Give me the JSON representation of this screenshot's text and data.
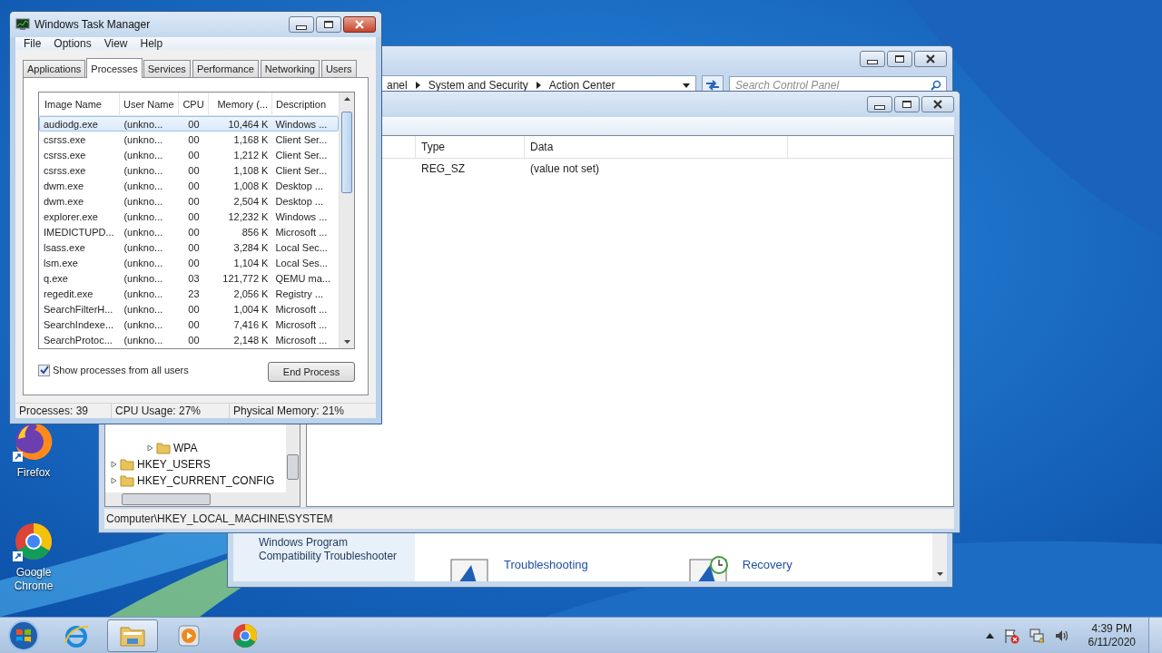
{
  "desktop": {
    "icons": [
      {
        "kind": "firefox",
        "label": "Firefox"
      },
      {
        "kind": "chrome",
        "label": "Google Chrome"
      }
    ]
  },
  "control_panel": {
    "breadcrumb": [
      "anel",
      "System and Security",
      "Action Center"
    ],
    "search": {
      "placeholder": "Search Control Panel"
    },
    "sidebar_link": "Windows Program Compatibility Troubleshooter",
    "items": [
      {
        "kind": "troubleshooting",
        "title": "Troubleshooting"
      },
      {
        "kind": "recovery",
        "title": "Recovery"
      }
    ]
  },
  "registry_editor": {
    "tree": [
      {
        "children": [
          {
            "label": "WPA",
            "expanded": false
          }
        ]
      },
      {
        "label": "HKEY_USERS",
        "expanded": false
      },
      {
        "label": "HKEY_CURRENT_CONFIG",
        "expanded": false
      }
    ],
    "columns": [
      "Type",
      "Data"
    ],
    "rows": [
      {
        "type": "REG_SZ",
        "data": "(value not set)"
      }
    ],
    "status_bar": "Computer\\HKEY_LOCAL_MACHINE\\SYSTEM"
  },
  "task_manager": {
    "title": "Windows Task Manager",
    "menu": [
      "File",
      "Options",
      "View",
      "Help"
    ],
    "tabs": [
      {
        "label": "Applications",
        "selected": false
      },
      {
        "label": "Processes",
        "selected": true
      },
      {
        "label": "Services",
        "selected": false
      },
      {
        "label": "Performance",
        "selected": false
      },
      {
        "label": "Networking",
        "selected": false
      },
      {
        "label": "Users",
        "selected": false
      }
    ],
    "columns": [
      "Image Name",
      "User Name",
      "CPU",
      "Memory (...",
      "Description"
    ],
    "processes": [
      {
        "image_name": "audiodg.exe",
        "user_name": "(unkno...",
        "cpu": "00",
        "memory": "10,464 K",
        "description": "Windows ...",
        "selected": true
      },
      {
        "image_name": "csrss.exe",
        "user_name": "(unkno...",
        "cpu": "00",
        "memory": "1,168 K",
        "description": "Client Ser...",
        "selected": false
      },
      {
        "image_name": "csrss.exe",
        "user_name": "(unkno...",
        "cpu": "00",
        "memory": "1,212 K",
        "description": "Client Ser...",
        "selected": false
      },
      {
        "image_name": "csrss.exe",
        "user_name": "(unkno...",
        "cpu": "00",
        "memory": "1,108 K",
        "description": "Client Ser...",
        "selected": false
      },
      {
        "image_name": "dwm.exe",
        "user_name": "(unkno...",
        "cpu": "00",
        "memory": "1,008 K",
        "description": "Desktop ...",
        "selected": false
      },
      {
        "image_name": "dwm.exe",
        "user_name": "(unkno...",
        "cpu": "00",
        "memory": "2,504 K",
        "description": "Desktop ...",
        "selected": false
      },
      {
        "image_name": "explorer.exe",
        "user_name": "(unkno...",
        "cpu": "00",
        "memory": "12,232 K",
        "description": "Windows ...",
        "selected": false
      },
      {
        "image_name": "IMEDICTUPD...",
        "user_name": "(unkno...",
        "cpu": "00",
        "memory": "856 K",
        "description": "Microsoft ...",
        "selected": false
      },
      {
        "image_name": "lsass.exe",
        "user_name": "(unkno...",
        "cpu": "00",
        "memory": "3,284 K",
        "description": "Local Sec...",
        "selected": false
      },
      {
        "image_name": "lsm.exe",
        "user_name": "(unkno...",
        "cpu": "00",
        "memory": "1,104 K",
        "description": "Local Ses...",
        "selected": false
      },
      {
        "image_name": "q.exe",
        "user_name": "(unkno...",
        "cpu": "03",
        "memory": "121,772 K",
        "description": "QEMU ma...",
        "selected": false
      },
      {
        "image_name": "regedit.exe",
        "user_name": "(unkno...",
        "cpu": "23",
        "memory": "2,056 K",
        "description": "Registry ...",
        "selected": false
      },
      {
        "image_name": "SearchFilterH...",
        "user_name": "(unkno...",
        "cpu": "00",
        "memory": "1,004 K",
        "description": "Microsoft ...",
        "selected": false
      },
      {
        "image_name": "SearchIndexe...",
        "user_name": "(unkno...",
        "cpu": "00",
        "memory": "7,416 K",
        "description": "Microsoft ...",
        "selected": false
      },
      {
        "image_name": "SearchProtoc...",
        "user_name": "(unkno...",
        "cpu": "00",
        "memory": "2,148 K",
        "description": "Microsoft ...",
        "selected": false
      }
    ],
    "show_all_users": {
      "label": "Show processes from all users",
      "checked": true
    },
    "end_process_button": "End Process",
    "status_bar": [
      "Processes: 39",
      "CPU Usage: 27%",
      "Physical Memory: 21%"
    ]
  },
  "taskbar": {
    "apps": [
      {
        "kind": "ie",
        "active": false
      },
      {
        "kind": "explorer",
        "active": true
      },
      {
        "kind": "media",
        "active": false
      },
      {
        "kind": "chrome",
        "active": false
      }
    ],
    "clock": {
      "time": "4:39 PM",
      "date": "6/11/2020"
    }
  }
}
